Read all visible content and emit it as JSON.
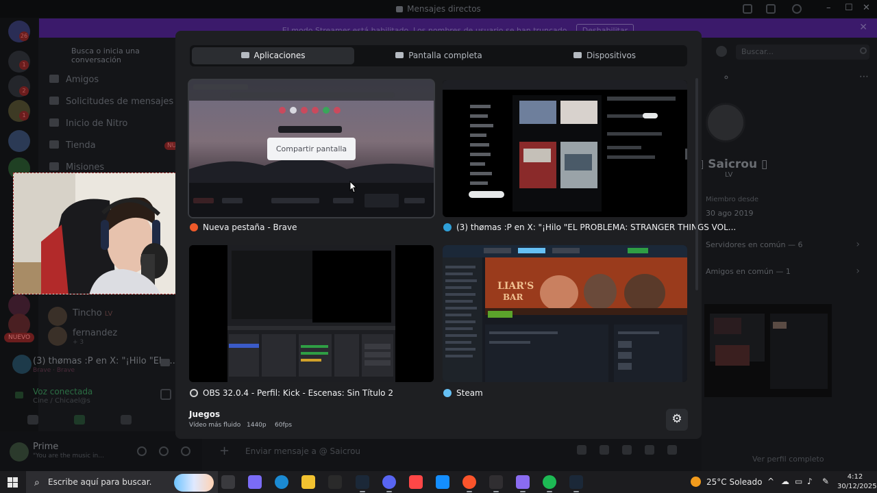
{
  "window": {
    "title": "Mensajes directos"
  },
  "streamer_banner": {
    "text": "El modo Streamer está habilitado. Los nombres de usuario se han truncado.",
    "button": "Deshabilitar"
  },
  "dm_sidebar": {
    "search_placeholder": "Busca o inicia una conversación",
    "nav": [
      {
        "label": "Amigos",
        "icon": "friends-icon"
      },
      {
        "label": "Solicitudes de mensajes",
        "icon": "mail-icon"
      },
      {
        "label": "Inicio de Nitro",
        "icon": "nitro-icon"
      },
      {
        "label": "Tienda",
        "icon": "shop-icon",
        "badge": "NU"
      },
      {
        "label": "Misiones",
        "icon": "quest-icon"
      }
    ],
    "dms": [
      {
        "name": "Tincho",
        "tag": "LV"
      },
      {
        "name": "fernandez",
        "sub": "+ 3"
      }
    ],
    "server_badges": [
      "26",
      "1",
      "2",
      "1"
    ],
    "new_badge": "NUEVO",
    "activity": "(3) thømas :P en X: \"¡Hilo \"EL ...",
    "activity_sub": "Brave · Brave",
    "voice_status": "Voz conectada",
    "voice_sub": "Cine / Chicael@s",
    "user": {
      "name": "Prime",
      "status": "\"You are the music in..."
    }
  },
  "message_input": {
    "placeholder": "Enviar mensaje a @ Saicrou"
  },
  "profile": {
    "search_placeholder": "Buscar...",
    "name": "Saicrou",
    "tag": "LV",
    "member_since_label": "Miembro desde",
    "member_since": "30 ago 2019",
    "mutual_servers": "Servidores en común — 6",
    "mutual_friends": "Amigos en común — 1",
    "view_full": "Ver perfil completo"
  },
  "share_modal": {
    "tabs": [
      {
        "label": "Aplicaciones",
        "icon": "app-window-icon",
        "active": true
      },
      {
        "label": "Pantalla completa",
        "icon": "monitor-icon",
        "active": false
      },
      {
        "label": "Dispositivos",
        "icon": "camera-icon",
        "active": false
      }
    ],
    "share_button": "Compartir pantalla",
    "windows": [
      {
        "label": "Nueva pestaña - Brave",
        "icon": "brave-icon",
        "icon_color": "#ef5a2a"
      },
      {
        "label": "(3) thømas :P en X: \"¡Hilo \"EL PROBLEMA: STRANGER THINGS VOL...",
        "icon": "edge-icon",
        "icon_color": "#2f9fd8"
      },
      {
        "label": "OBS 32.0.4 - Perfil: Kick - Escenas: Sin Título 2",
        "icon": "obs-icon",
        "icon_color": "#d0d0d0"
      },
      {
        "label": "Steam",
        "icon": "steam-icon",
        "icon_color": "#66c0f4"
      }
    ],
    "games_title": "Juegos",
    "games_meta": [
      "Vídeo más fluido",
      "1440p",
      "60fps"
    ]
  },
  "taskbar": {
    "search_placeholder": "Escribe aquí para buscar.",
    "weather": "25°C  Soleado",
    "time": "4:12",
    "date": "30/12/2025",
    "apps": [
      {
        "name": "task-view-icon",
        "color": "#3a3a3e"
      },
      {
        "name": "copilot-icon",
        "color": "#7b6cf6"
      },
      {
        "name": "edge-icon",
        "color": "#1b8ad3"
      },
      {
        "name": "file-explorer-icon",
        "color": "#f2c230"
      },
      {
        "name": "epic-games-icon",
        "color": "#2a2a2a"
      },
      {
        "name": "steam-icon",
        "color": "#1b2838"
      },
      {
        "name": "discord-icon",
        "color": "#5865f2"
      },
      {
        "name": "ea-icon",
        "color": "#ff4747"
      },
      {
        "name": "battlenet-icon",
        "color": "#148eff"
      },
      {
        "name": "brave-icon",
        "color": "#fb542b"
      },
      {
        "name": "obs-icon",
        "color": "#302e31"
      },
      {
        "name": "gamepad-icon",
        "color": "#8a6cf0"
      },
      {
        "name": "spotify-icon",
        "color": "#1db954"
      },
      {
        "name": "steam-icon-2",
        "color": "#1b2838"
      }
    ]
  }
}
